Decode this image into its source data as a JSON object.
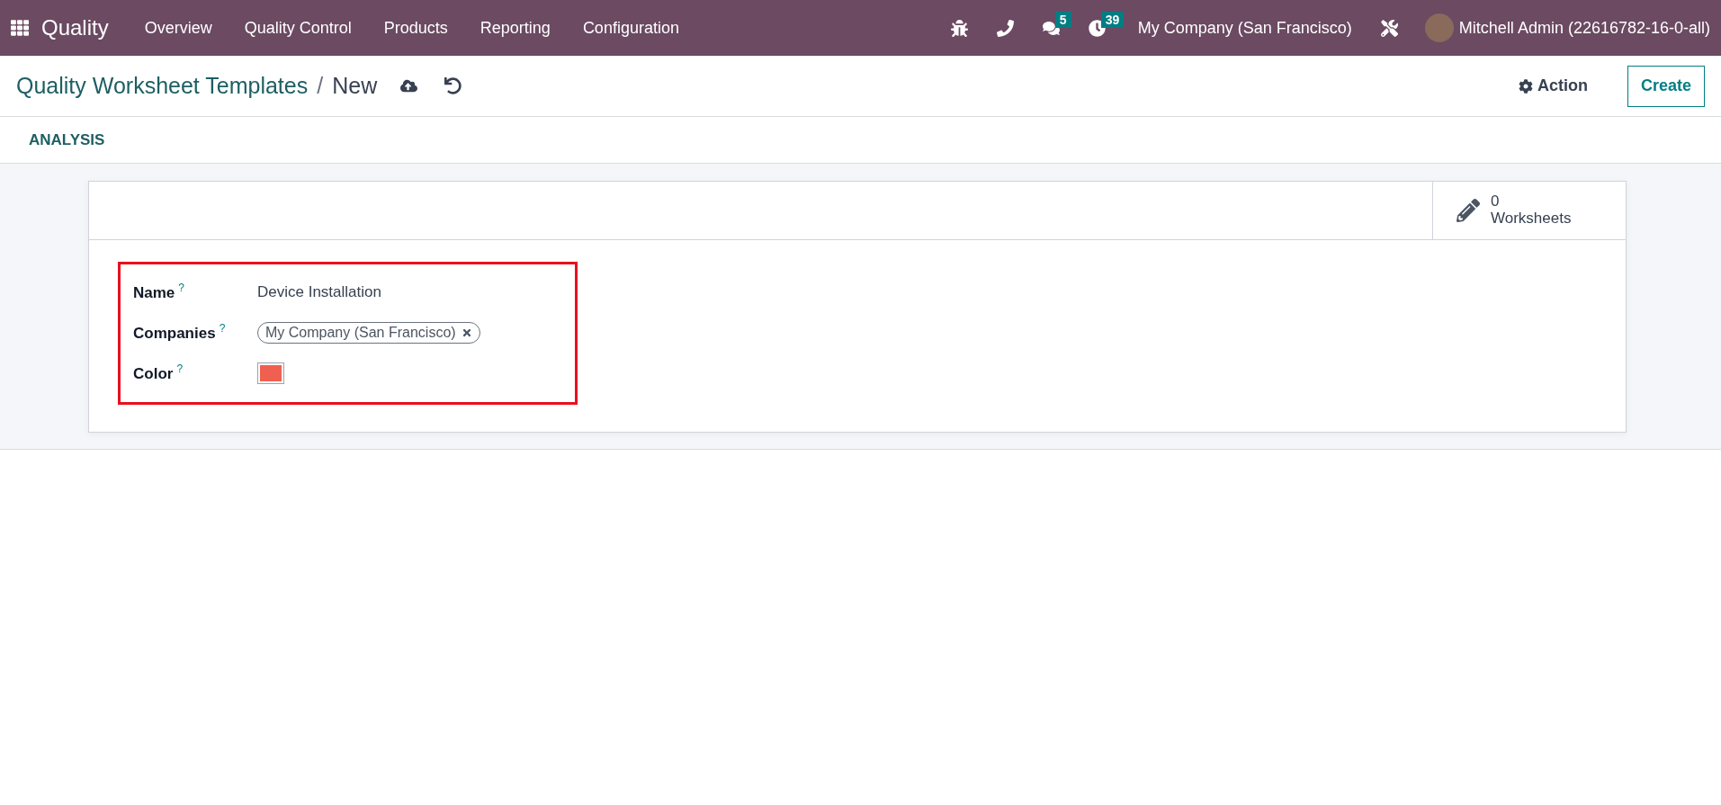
{
  "navbar": {
    "app_name": "Quality",
    "menu": [
      "Overview",
      "Quality Control",
      "Products",
      "Reporting",
      "Configuration"
    ],
    "systray": [
      {
        "kind": "bug"
      },
      {
        "kind": "phone"
      },
      {
        "kind": "chat",
        "badge": "5"
      },
      {
        "kind": "activity",
        "badge": "39"
      }
    ],
    "company": "My Company (San Francisco)",
    "user": "Mitchell Admin (22616782-16-0-all)"
  },
  "breadcrumb": {
    "parent": "Quality Worksheet Templates",
    "separator": "/",
    "current": "New"
  },
  "control_panel": {
    "action": "Action",
    "create": "Create"
  },
  "header_buttons": [
    "ANALYSIS"
  ],
  "stat_button": {
    "value": "0",
    "label": "Worksheets"
  },
  "form": {
    "highlighted": true,
    "fields": [
      {
        "kind": "text",
        "label": "Name",
        "help": "?",
        "value": "Device Installation"
      },
      {
        "kind": "tags",
        "label": "Companies",
        "help": "?",
        "tags": [
          "My Company (San Francisco)"
        ]
      },
      {
        "kind": "color",
        "label": "Color",
        "help": "?",
        "color": "#f06050"
      }
    ]
  }
}
